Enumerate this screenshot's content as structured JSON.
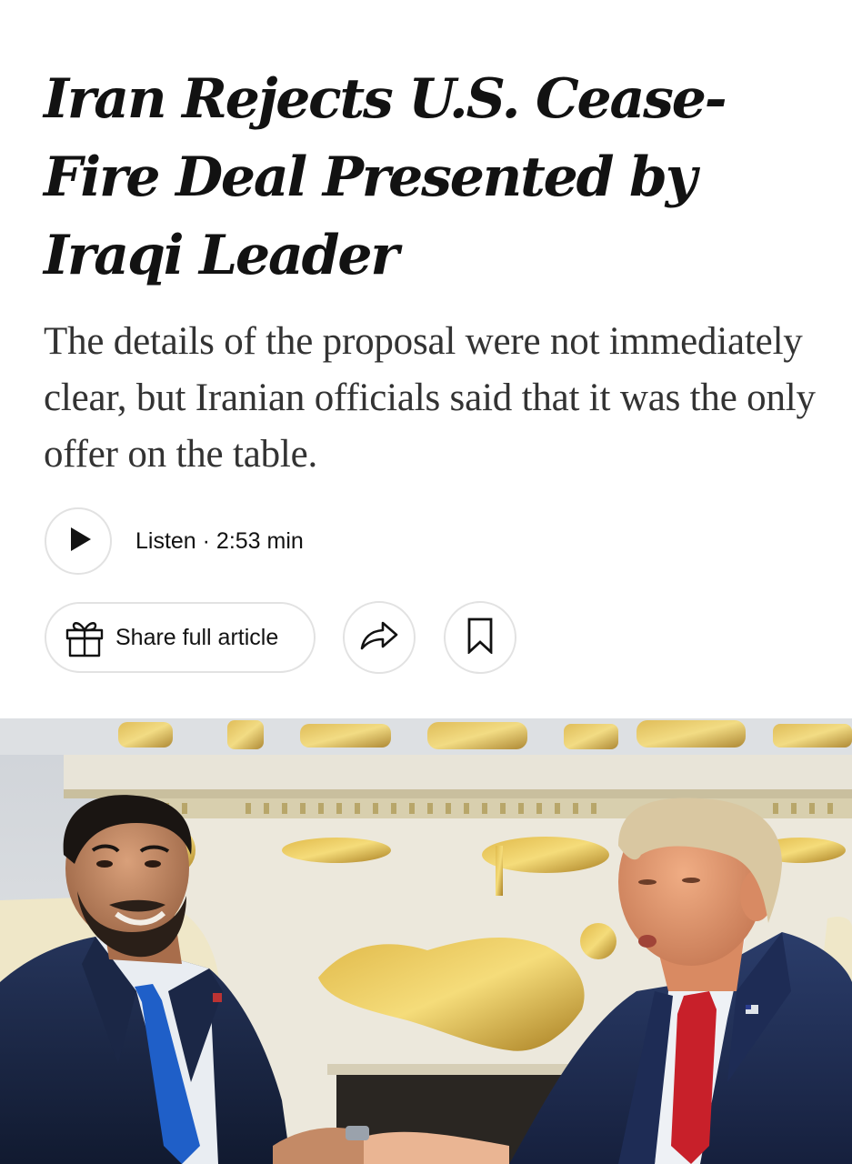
{
  "article": {
    "headline": "Iran Rejects U.S. Cease-Fire Deal Presented by Iraqi Leader",
    "summary": "The details of the proposal were not immediately clear, but Iranian officials said that it was the only offer on the table."
  },
  "audio": {
    "listen_label": "Listen · 2:53 min",
    "play_icon": "play-icon"
  },
  "actions": {
    "share_full_label": "Share full article",
    "gift_icon": "gift-icon",
    "share_icon": "share-arrow-icon",
    "save_icon": "bookmark-icon"
  },
  "colors": {
    "text": "#121212",
    "summary_text": "#333333",
    "border": "#e2e2e2",
    "background": "#ffffff"
  }
}
